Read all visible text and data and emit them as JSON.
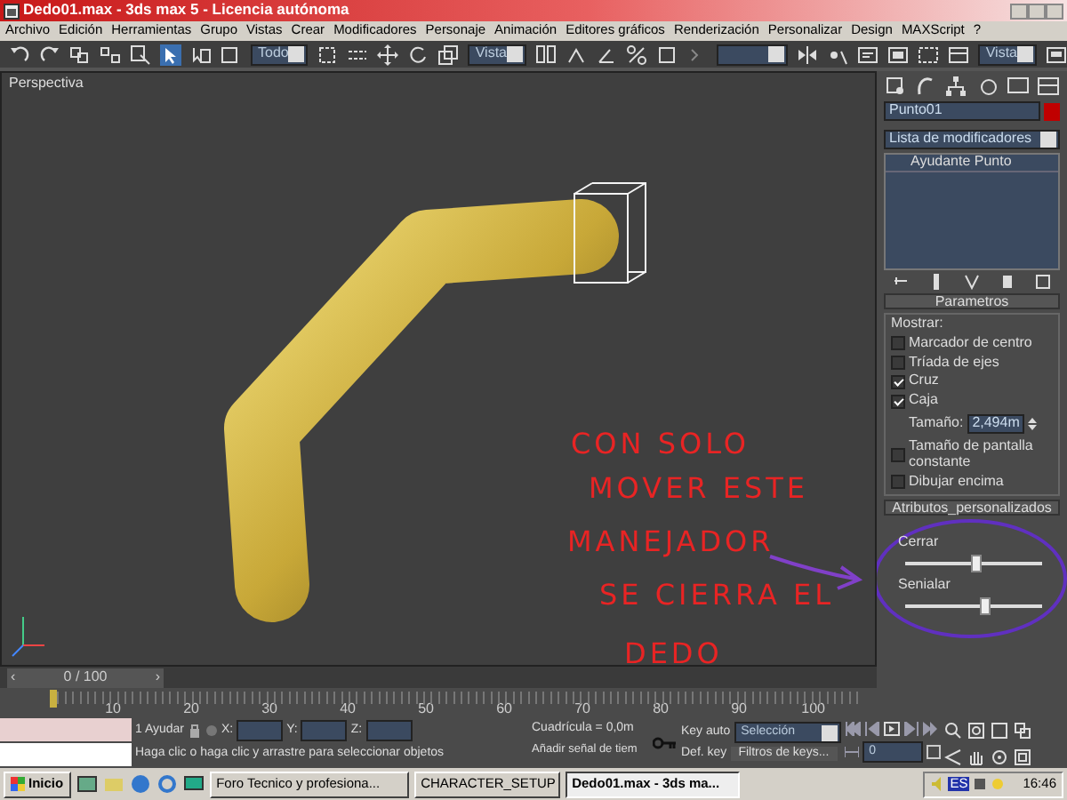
{
  "title_bar": {
    "title": "Dedo01.max - 3ds max 5 - Licencia autónoma"
  },
  "menu": [
    "Archivo",
    "Edición",
    "Herramientas",
    "Grupo",
    "Vistas",
    "Crear",
    "Modificadores",
    "Personaje",
    "Animación",
    "Editores gráficos",
    "Renderización",
    "Personalizar",
    "Design",
    "MAXScript",
    "?"
  ],
  "toolbar": {
    "selection_filter": "Todo",
    "coord_system": "Vista",
    "render_view": "Vista"
  },
  "viewport": {
    "label": "Perspectiva",
    "note_lines": [
      "CON SOLO",
      "MOVER ESTE",
      "MANEJADOR",
      "SE CIERRA EL",
      "DEDO"
    ]
  },
  "command_panel": {
    "object_name": "Punto01",
    "modifier_list": "Lista de modificadores",
    "stack": [
      "Ayudante Punto"
    ],
    "parameters": {
      "title": "Parametros",
      "group": "Mostrar:",
      "options": [
        {
          "label": "Marcador de centro",
          "checked": false
        },
        {
          "label": "Tríada de ejes",
          "checked": false
        },
        {
          "label": "Cruz",
          "checked": true
        },
        {
          "label": "Caja",
          "checked": true
        }
      ],
      "size_label": "Tamaño:",
      "size_value": "2,494m",
      "options2": [
        {
          "label": "Tamaño de pantalla constante",
          "checked": false
        },
        {
          "label": "Dibujar encima",
          "checked": false
        }
      ]
    },
    "custom": {
      "title": "Atributos_personalizados",
      "sliders": [
        {
          "label": "Cerrar",
          "level": 0.52
        },
        {
          "label": "Senialar",
          "level": 0.58
        }
      ]
    }
  },
  "timeline": {
    "frame": "0 / 100",
    "prev": "‹",
    "next": "›",
    "ticks": [
      "10",
      "20",
      "30",
      "40",
      "50",
      "60",
      "70",
      "80",
      "90",
      "100"
    ]
  },
  "status": {
    "selected": "1 Ayudar",
    "x": "X:",
    "y": "Y:",
    "z": "Z:",
    "grid": "Cuadrícula = 0,0m",
    "key_auto": "Key auto",
    "key_mode": "Selección",
    "def_key": "Def. key",
    "key_filters": "Filtros de keys...",
    "frame_value": "0",
    "prompt": "Haga clic o haga clic y arrastre para seleccionar objetos",
    "time_tag": "Añadir señal de tiem"
  },
  "taskbar": {
    "start": "Inicio",
    "tasks": [
      {
        "label": "Foro Tecnico y profesiona...",
        "selected": false
      },
      {
        "label": "CHARACTER_SETUP",
        "selected": false
      },
      {
        "label": "Dedo01.max - 3ds ma...",
        "selected": true
      }
    ],
    "language": "ES",
    "clock": "16:46"
  }
}
